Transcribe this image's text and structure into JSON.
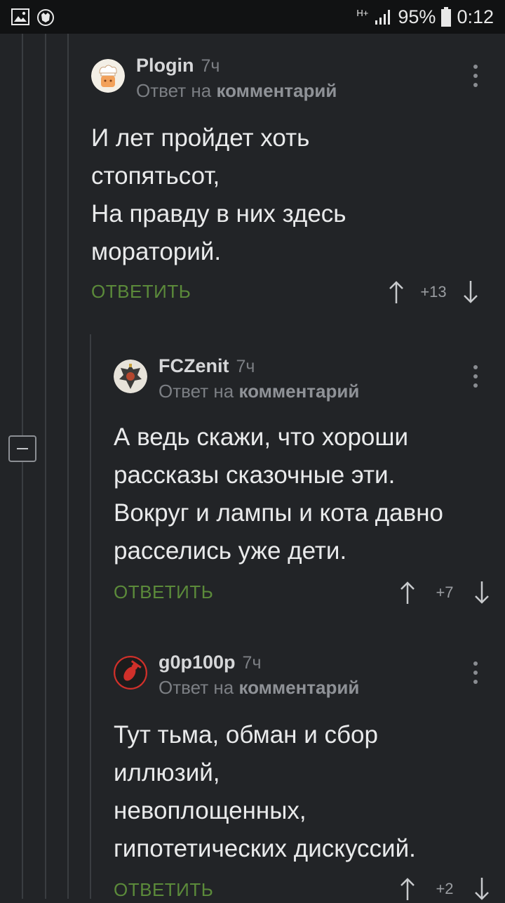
{
  "status_bar": {
    "network": "H+",
    "battery": "95%",
    "time": "0:12"
  },
  "comments": [
    {
      "author": "Plogin",
      "time": "7ч",
      "reply_prefix": "Ответ на",
      "reply_target": "комментарий",
      "lines": [
        "И лет пройдет хоть",
        "стопятьсот,",
        "На правду в них здесь",
        "мораторий."
      ],
      "reply_label": "ОТВЕТИТЬ",
      "votes": "+13"
    },
    {
      "author": "FCZenit",
      "time": "7ч",
      "reply_prefix": "Ответ на",
      "reply_target": "комментарий",
      "lines": [
        "А ведь скажи, что хороши",
        "рассказы сказочные эти.",
        "Вокруг и лампы и кота давно",
        "расселись уже дети."
      ],
      "reply_label": "ОТВЕТИТЬ",
      "votes": "+7"
    },
    {
      "author": "g0p100p",
      "time": "7ч",
      "reply_prefix": "Ответ на",
      "reply_target": "комментарий",
      "lines": [
        "Тут тьма, обман и сбор",
        "иллюзий,",
        "невоплощенных,",
        "гипотетических дискуссий."
      ],
      "reply_label": "ОТВЕТИТЬ",
      "votes": "+2"
    }
  ]
}
